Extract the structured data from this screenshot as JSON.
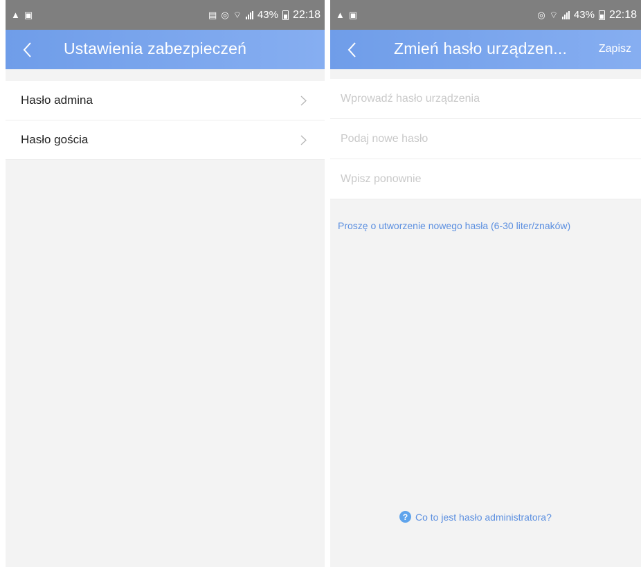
{
  "left_screen": {
    "status_bar": {
      "battery_percent": "43%",
      "time": "22:18"
    },
    "app_bar": {
      "title": "Ustawienia zabezpieczeń"
    },
    "menu_items": [
      {
        "label": "Hasło admina"
      },
      {
        "label": "Hasło gościa"
      }
    ]
  },
  "right_screen": {
    "status_bar": {
      "battery_percent": "43%",
      "time": "22:18"
    },
    "app_bar": {
      "title": "Zmień hasło urządzen...",
      "save_label": "Zapisz"
    },
    "fields": [
      {
        "placeholder": "Wprowadź hasło urządzenia",
        "value": ""
      },
      {
        "placeholder": "Podaj nowe hasło",
        "value": ""
      },
      {
        "placeholder": "Wpisz ponownie",
        "value": ""
      }
    ],
    "hint": "Proszę o utworzenie nowego hasła (6-30 liter/znaków)",
    "help_link": {
      "icon": "question-icon",
      "label": "Co to jest hasło administratora?"
    }
  },
  "colors": {
    "status_bar": "#7f7f7f",
    "app_bar_start": "#6f9de9",
    "app_bar_end": "#86aef1",
    "accent_text": "#5b8fe0",
    "background": "#f3f3f3"
  }
}
